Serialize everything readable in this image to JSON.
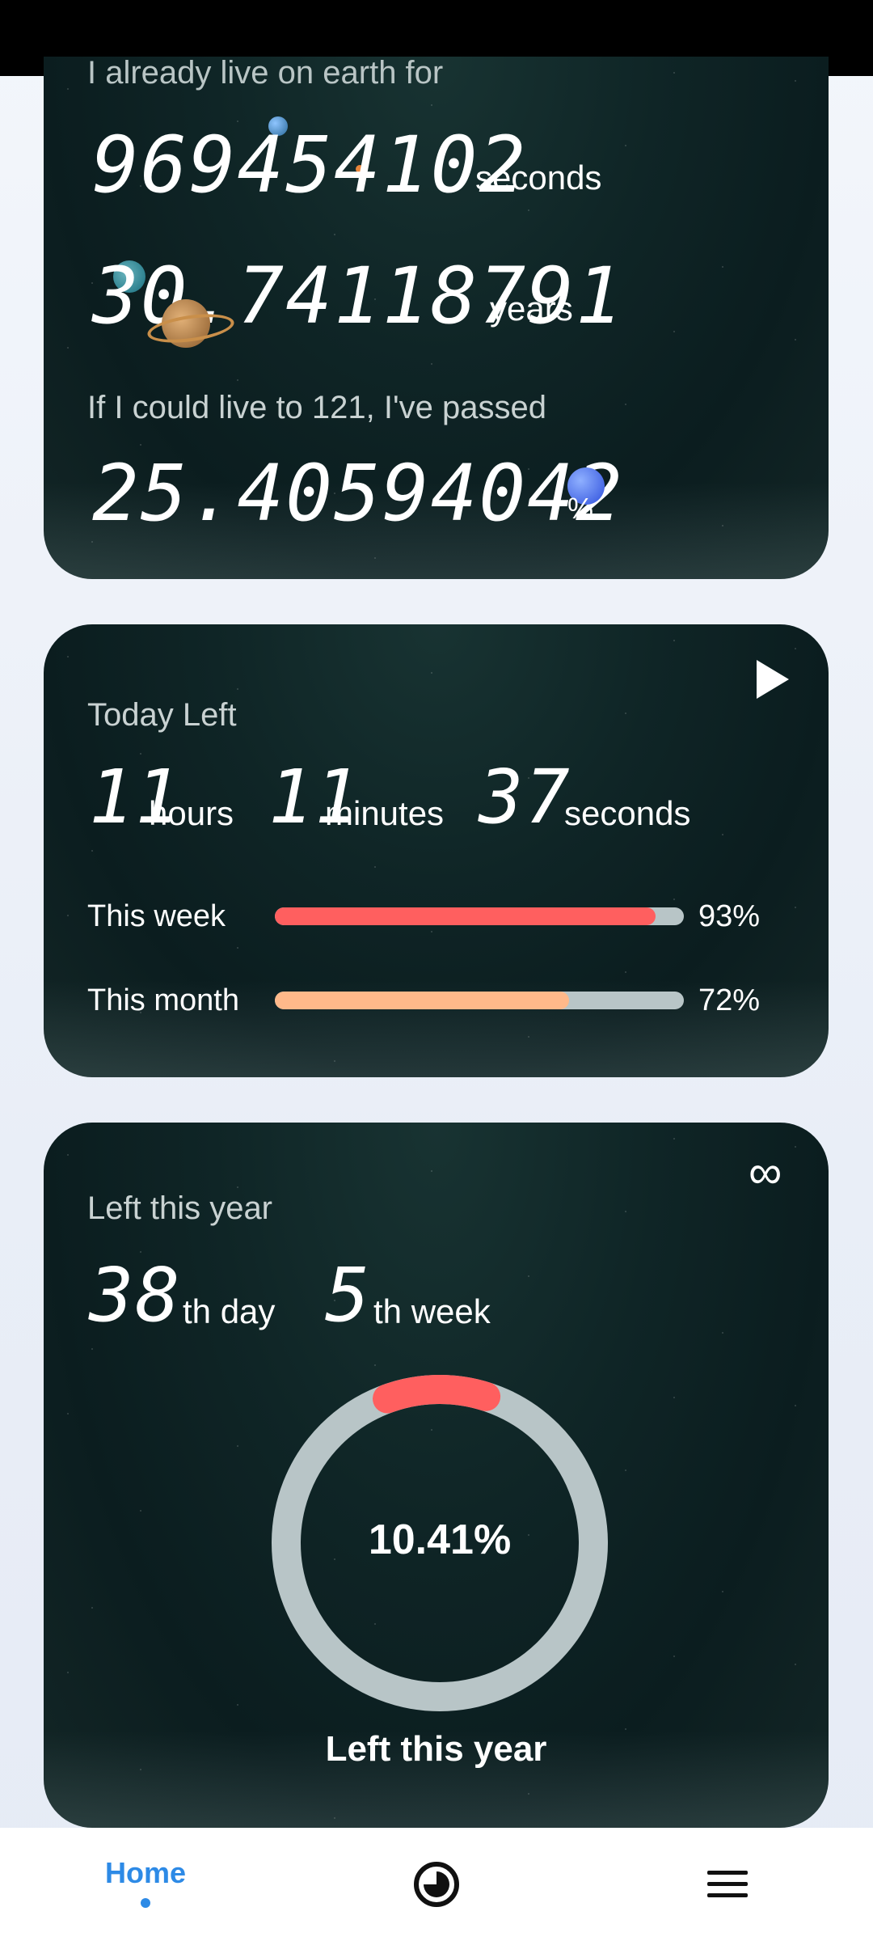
{
  "card1": {
    "intro_text": "I already live on earth for",
    "seconds_value": "969454102",
    "seconds_unit": "seconds",
    "years_value": "30.74118791",
    "years_unit": "years",
    "passed_text": "If I could live to 121, I've passed",
    "percent_value": "25.40594042",
    "percent_unit": "%"
  },
  "card2": {
    "title": "Today Left",
    "hours_value": "11",
    "hours_unit": "hours",
    "minutes_value": "11",
    "minutes_unit": "minutes",
    "seconds_value": "37",
    "seconds_unit": "seconds",
    "week_label": "This week",
    "week_percent_text": "93%",
    "week_fraction": 0.93,
    "week_color": "#ff5f5f",
    "month_label": "This month",
    "month_percent_text": "72%",
    "month_fraction": 0.72,
    "month_color": "#ffb98a"
  },
  "card3": {
    "title": "Left this year",
    "day_value": "38",
    "day_unit": "th day",
    "week_value": "5",
    "week_unit": "th week",
    "ring_percent_text": "10.41%",
    "ring_fraction": 0.1041,
    "ring_color": "#ff5f5f",
    "ring_track_color": "#b8c5c7",
    "ring_label": "Left this year"
  },
  "nav": {
    "home_label": "Home",
    "accent_color": "#2d8ae6",
    "icons": [
      "clock-icon",
      "menu-icon"
    ]
  }
}
